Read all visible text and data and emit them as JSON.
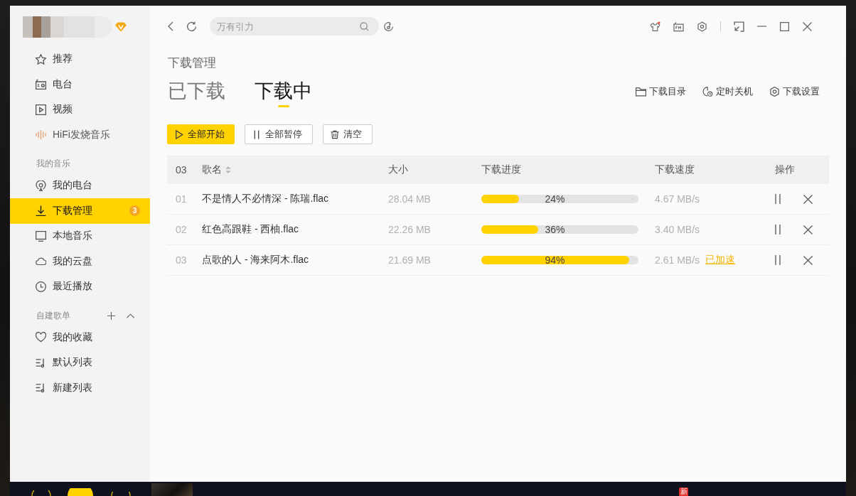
{
  "sidebar": {
    "items": [
      {
        "label": "推荐",
        "selected": false
      },
      {
        "label": "电台",
        "selected": false
      },
      {
        "label": "视频",
        "selected": false
      },
      {
        "label": "HiFi发烧音乐",
        "selected": false
      }
    ],
    "sections": [
      {
        "title": "我的音乐",
        "items": [
          {
            "label": "我的电台",
            "selected": false
          },
          {
            "label": "下载管理",
            "selected": true,
            "badge": "3"
          },
          {
            "label": "本地音乐",
            "selected": false
          },
          {
            "label": "我的云盘",
            "selected": false
          },
          {
            "label": "最近播放",
            "selected": false
          }
        ]
      },
      {
        "title": "自建歌单",
        "expanded": true,
        "items": [
          {
            "label": "我的收藏",
            "selected": false
          },
          {
            "label": "默认列表",
            "selected": false
          },
          {
            "label": "新建列表",
            "selected": false
          }
        ]
      }
    ]
  },
  "toolbar": {
    "search": {
      "placeholder": "万有引力"
    },
    "skin_dot": true
  },
  "page": {
    "title": "下载管理",
    "tabs": [
      {
        "label": "已下载",
        "selected": false
      },
      {
        "label": "下载中",
        "selected": true
      }
    ],
    "actions": [
      "下载目录",
      "定时关机",
      "下载设置"
    ],
    "buttons": [
      {
        "label": "全部开始",
        "kind": "primary"
      },
      {
        "label": "全部暂停",
        "kind": "secondary"
      },
      {
        "label": "清空",
        "kind": "secondary"
      }
    ]
  },
  "table": {
    "columns": [
      {
        "label": "03",
        "sortable": false
      },
      {
        "label": "歌名",
        "sortable": true
      },
      {
        "label": "大小",
        "sortable": false
      },
      {
        "label": "下载进度",
        "sortable": false
      },
      {
        "label": "下载速度",
        "sortable": false
      },
      {
        "label": "操作",
        "sortable": false
      }
    ],
    "rows": [
      {
        "index": "01",
        "name": "不是情人不必情深 - 陈瑞.flac",
        "size": "28.04 MB",
        "level": 0.24,
        "progress": "24%",
        "speed": "4.67 MB/s"
      },
      {
        "index": "02",
        "name": "红色高跟鞋 - 西柚.flac",
        "size": "22.26 MB",
        "level": 0.36,
        "progress": "36%",
        "speed": "3.40 MB/s"
      },
      {
        "index": "03",
        "name": "点歌的人 - 海来阿木.flac",
        "size": "21.69 MB",
        "level": 0.94,
        "progress": "94%",
        "speed": "2.61 MB/s",
        "boost": "已加速"
      }
    ]
  },
  "player_bar": {
    "new_badge": "新"
  }
}
